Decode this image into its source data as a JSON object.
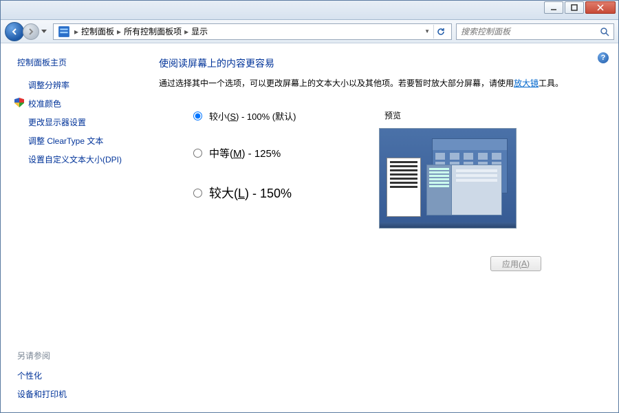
{
  "breadcrumb": {
    "seg1": "控制面板",
    "seg2": "所有控制面板项",
    "seg3": "显示"
  },
  "search": {
    "placeholder": "搜索控制面板"
  },
  "sidebar": {
    "home": "控制面板主页",
    "links": [
      {
        "label": "调整分辨率"
      },
      {
        "label": "校准颜色"
      },
      {
        "label": "更改显示器设置"
      },
      {
        "label": "调整 ClearType 文本"
      },
      {
        "label": "设置自定义文本大小(DPI)"
      }
    ],
    "see_also_header": "另请参阅",
    "see_also": [
      {
        "label": "个性化"
      },
      {
        "label": "设备和打印机"
      }
    ]
  },
  "main": {
    "title": "使阅读屏幕上的内容更容易",
    "desc_before": "通过选择其中一个选项，可以更改屏幕上的文本大小以及其他项。若要暂时放大部分屏幕，请使用",
    "desc_link": "放大镜",
    "desc_after": "工具。",
    "preview_label": "预览",
    "options": {
      "small_pre": "较小(",
      "small_key": "S",
      "small_post": ") - 100% (默认)",
      "med_pre": "中等(",
      "med_key": "M",
      "med_post": ") - 125%",
      "large_pre": "较大(",
      "large_key": "L",
      "large_post": ") - 150%"
    },
    "apply_pre": "应用(",
    "apply_key": "A",
    "apply_post": ")"
  },
  "help": "?"
}
